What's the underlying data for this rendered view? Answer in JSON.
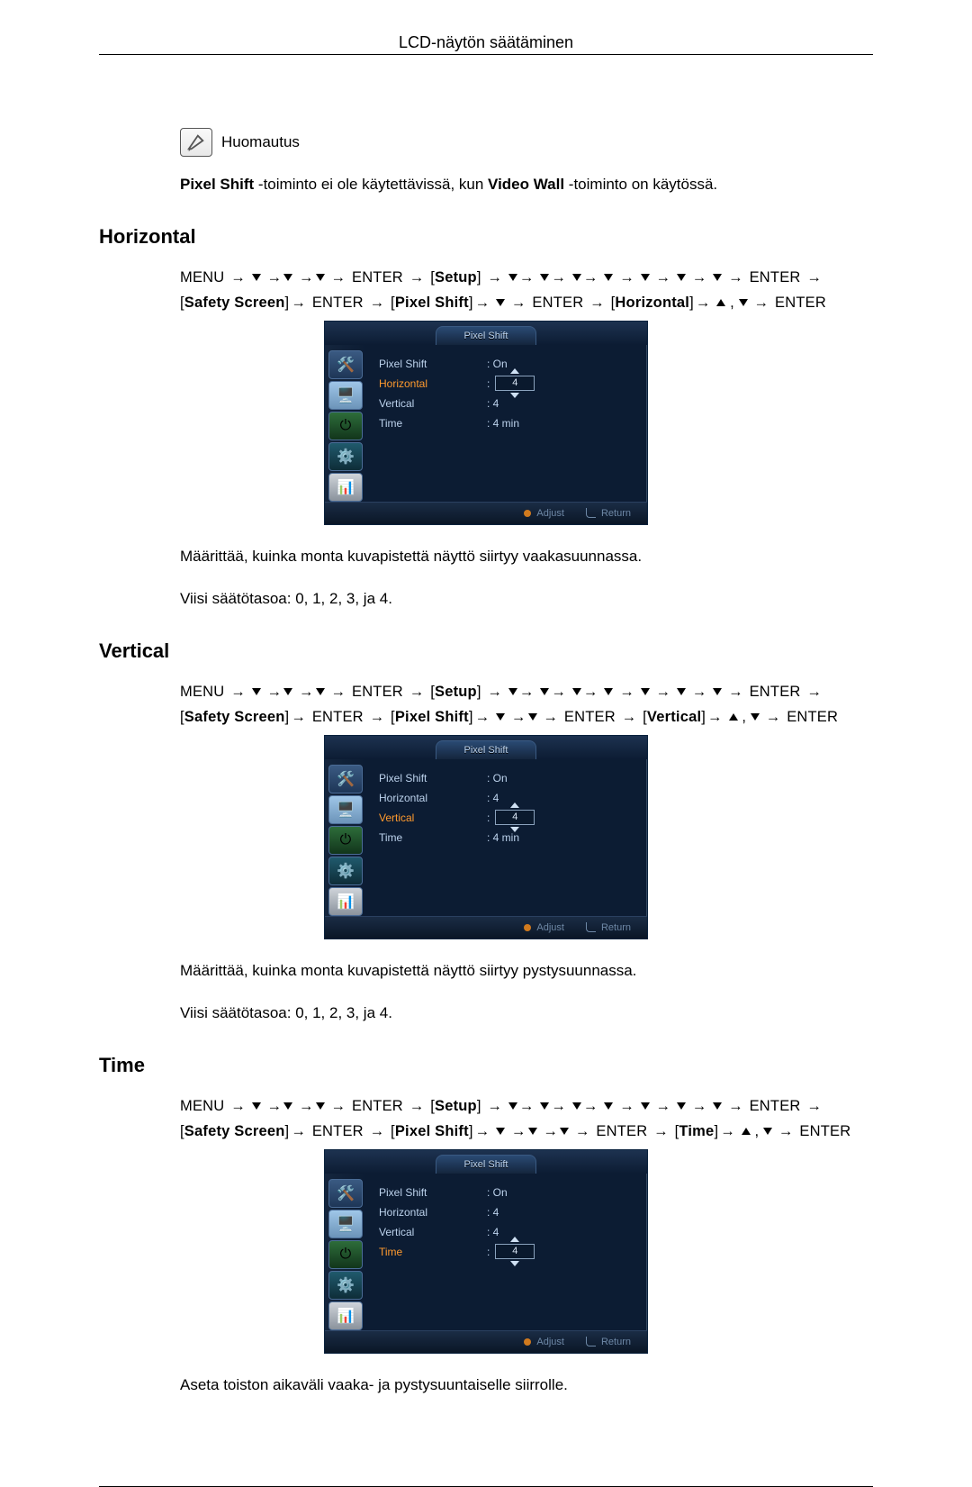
{
  "header": {
    "title": "LCD-näytön säätäminen"
  },
  "note": {
    "label": "Huomautus",
    "text_prefix": "Pixel Shift",
    "text_mid": " -toiminto ei ole käytettävissä, kun ",
    "text_bold2": "Video Wall",
    "text_suffix": " -toiminto on käytössä."
  },
  "sections": {
    "horizontal": {
      "heading": "Horizontal",
      "nav": {
        "menu": "MENU",
        "enter": "ENTER",
        "setup": "Setup",
        "safety": "Safety Screen",
        "pixel": "Pixel Shift",
        "target": "Horizontal"
      },
      "desc1": "Määrittää, kuinka monta kuvapistettä näyttö siirtyy vaakasuunnassa.",
      "desc2": "Viisi säätötasoa: 0, 1, 2, 3, ja 4."
    },
    "vertical": {
      "heading": "Vertical",
      "nav": {
        "menu": "MENU",
        "enter": "ENTER",
        "setup": "Setup",
        "safety": "Safety Screen",
        "pixel": "Pixel Shift",
        "target": "Vertical"
      },
      "desc1": "Määrittää, kuinka monta kuvapistettä näyttö siirtyy pystysuunnassa.",
      "desc2": "Viisi säätötasoa: 0, 1, 2, 3, ja 4."
    },
    "time": {
      "heading": "Time",
      "nav": {
        "menu": "MENU",
        "enter": "ENTER",
        "setup": "Setup",
        "safety": "Safety Screen",
        "pixel": "Pixel Shift",
        "target": "Time"
      },
      "desc1": "Aseta toiston aikaväli vaaka- ja pystysuuntaiselle siirrolle."
    }
  },
  "osd": {
    "tab": "Pixel Shift",
    "rows": {
      "pixel_shift": "Pixel Shift",
      "horizontal": "Horizontal",
      "vertical": "Vertical",
      "time": "Time"
    },
    "values": {
      "on": ": On",
      "four": ": 4",
      "four_box": "4",
      "four_min": ": 4 min"
    },
    "footer": {
      "adjust": "Adjust",
      "return": "Return"
    }
  }
}
